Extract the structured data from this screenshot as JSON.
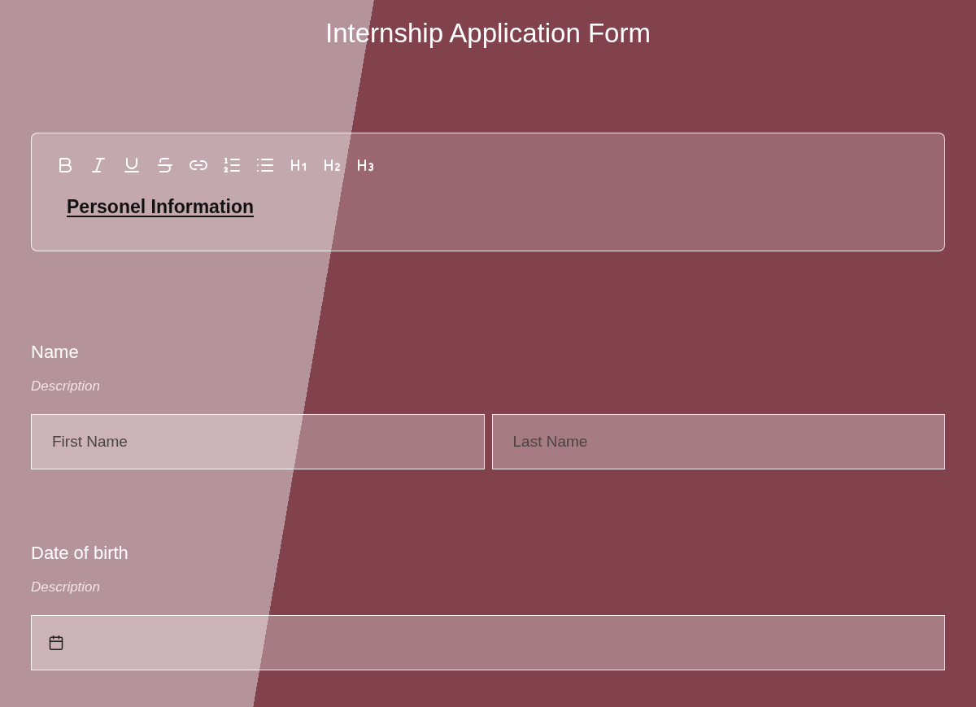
{
  "title": "Internship Application Form",
  "editor": {
    "heading": "Personel Information"
  },
  "fields": [
    {
      "label": "Name",
      "description": "Description",
      "inputs": [
        {
          "kind": "text",
          "placeholder": "First Name"
        },
        {
          "kind": "text",
          "placeholder": "Last Name"
        }
      ]
    },
    {
      "label": "Date of birth",
      "description": "Description",
      "inputs": [
        {
          "kind": "date"
        }
      ]
    }
  ]
}
